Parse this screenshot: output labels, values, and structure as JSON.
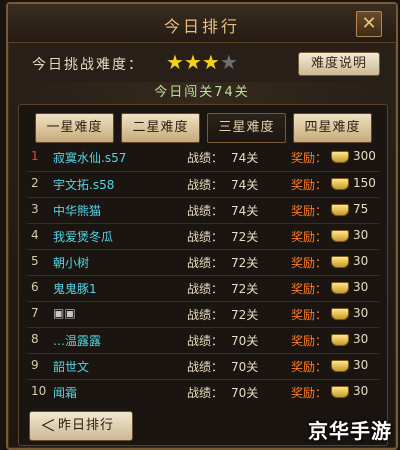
{
  "header": {
    "title": "今日排行",
    "close_icon": "close-icon"
  },
  "difficulty": {
    "label": "今日挑战难度：",
    "stars_filled": 3,
    "stars_total": 4,
    "help_button": "难度说明"
  },
  "today_pass": "今日闯关74关",
  "tabs": [
    {
      "label": "一星难度",
      "active": false
    },
    {
      "label": "二星难度",
      "active": false
    },
    {
      "label": "三星难度",
      "active": true
    },
    {
      "label": "四星难度",
      "active": false
    }
  ],
  "table": {
    "rows": [
      {
        "rank": "1",
        "name": "寂寞水仙.s57",
        "score_label": "战绩：",
        "score": "74关",
        "reward_label": "奖励：",
        "reward": "300"
      },
      {
        "rank": "2",
        "name": "宇文拓.s58",
        "score_label": "战绩：",
        "score": "74关",
        "reward_label": "奖励：",
        "reward": "150"
      },
      {
        "rank": "3",
        "name": "中华熊猫",
        "score_label": "战绩：",
        "score": "74关",
        "reward_label": "奖励：",
        "reward": "75"
      },
      {
        "rank": "4",
        "name": "我爱煲冬瓜",
        "score_label": "战绩：",
        "score": "72关",
        "reward_label": "奖励：",
        "reward": "30"
      },
      {
        "rank": "5",
        "name": "朝小树",
        "score_label": "战绩：",
        "score": "72关",
        "reward_label": "奖励：",
        "reward": "30"
      },
      {
        "rank": "6",
        "name": "鬼鬼豚1",
        "score_label": "战绩：",
        "score": "72关",
        "reward_label": "奖励：",
        "reward": "30"
      },
      {
        "rank": "7",
        "name": "▣▣",
        "score_label": "战绩：",
        "score": "72关",
        "reward_label": "奖励：",
        "reward": "30"
      },
      {
        "rank": "8",
        "name": "…温露露",
        "score_label": "战绩：",
        "score": "70关",
        "reward_label": "奖励：",
        "reward": "30"
      },
      {
        "rank": "9",
        "name": "韶世文",
        "score_label": "战绩：",
        "score": "70关",
        "reward_label": "奖励：",
        "reward": "30"
      },
      {
        "rank": "10",
        "name": "闻霜",
        "score_label": "战绩：",
        "score": "70关",
        "reward_label": "奖励：",
        "reward": "30"
      }
    ]
  },
  "footer": {
    "yesterday_button": "昨日排行",
    "arrow_icon": "chevron-left-icon"
  },
  "watermark": "京华手游",
  "colors": {
    "accent_gold": "#e7c07a",
    "rank_top": "#ff3b32",
    "player_name": "#55d4e6",
    "reward_label": "#ff7d2a"
  }
}
